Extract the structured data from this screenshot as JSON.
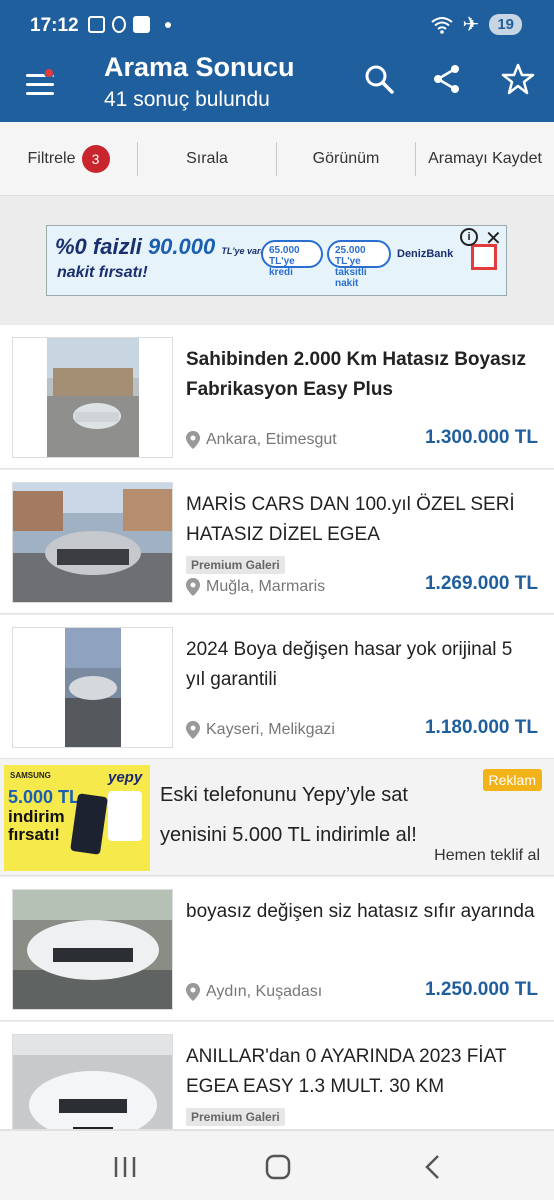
{
  "status_bar": {
    "time": "17:12",
    "battery": "19"
  },
  "header": {
    "title": "Arama Sonucu",
    "subtitle": "41 sonuç bulundu"
  },
  "filter_bar": {
    "filter_label": "Filtrele",
    "filter_count": "3",
    "sort_label": "Sırala",
    "view_label": "Görünüm",
    "save_label": "Aramayı Kaydet"
  },
  "ad_banner": {
    "line1_prefix": "%0 faizli",
    "line1_amount": "90.000",
    "line1_suffix": "TL'ye varan",
    "line2": "nakit fırsatı!",
    "pill1": "65.000 TL'ye kredi",
    "pill2": "25.000 TL'ye taksitli nakit",
    "bank": "DenizBank"
  },
  "listings": [
    {
      "title": "Sahibinden 2.000 Km Hatasız Boyasız Fabrikasyon Easy Plus",
      "location": "Ankara, Etimesgut",
      "price": "1.300.000 TL",
      "premium": ""
    },
    {
      "title": "MARİS CARS DAN 100.yıl ÖZEL SERİ HATASIZ DİZEL EGEA",
      "location": "Muğla, Marmaris",
      "price": "1.269.000 TL",
      "premium": "Premium Galeri"
    },
    {
      "title": "2024 Boya değişen hasar yok orijinal 5 yıl garantili",
      "location": "Kayseri, Melikgazi",
      "price": "1.180.000 TL",
      "premium": ""
    },
    {
      "title": "boyasız değişen siz hatasız sıfır ayarında",
      "location": "Aydın, Kuşadası",
      "price": "1.250.000 TL",
      "premium": ""
    },
    {
      "title": "ANILLAR'dan 0 AYARINDA 2023 FİAT EGEA EASY 1.3 MULT. 30 KM",
      "location": "",
      "price": "",
      "premium": "Premium Galeri"
    }
  ],
  "promo": {
    "text": "Eski telefonunu Yepy’yle sat yenisini 5.000 TL indirimle al!",
    "tag": "Reklam",
    "cta": "Hemen teklif al",
    "img_brand": "SAMSUNG",
    "img_logo": "yepy",
    "img_amount": "5.000 TL",
    "img_line2": "indirim",
    "img_line3": "fırsatı!"
  },
  "colors": {
    "header": "#1f5f9d",
    "price": "#1f5f9d",
    "badge": "#c8252c",
    "tag": "#f2b318"
  }
}
